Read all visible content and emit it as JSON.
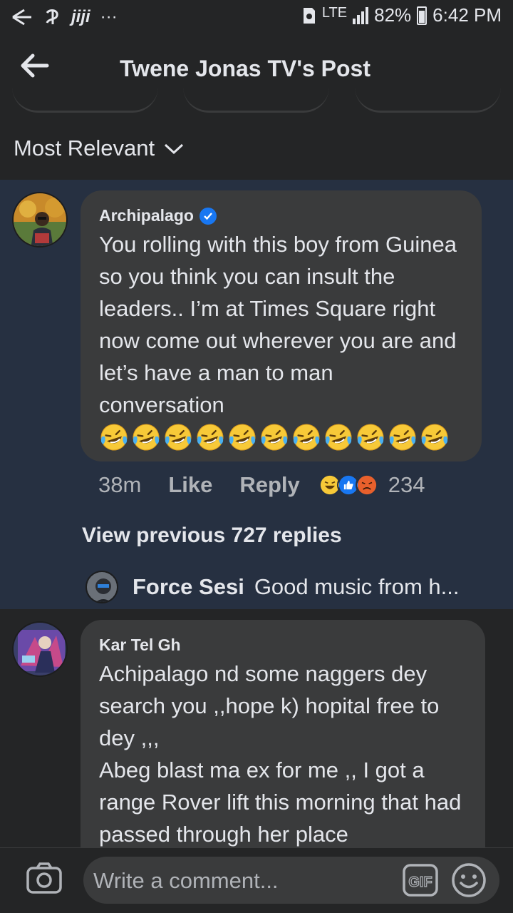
{
  "status_bar": {
    "left_icons": [
      "back-arrow-status-icon",
      "bluetooth-like-icon",
      "jiji-app-icon",
      "more-dots-icon"
    ],
    "jiji_label": "jiji",
    "dots": "···",
    "network": "LTE",
    "battery": "82%",
    "time": "6:42 PM"
  },
  "header": {
    "title": "Twene Jonas TV's Post"
  },
  "sort": {
    "label": "Most Relevant"
  },
  "comments": [
    {
      "author": "Archipalago",
      "verified": true,
      "text": "You rolling with this boy from Guinea so you think you can insult the leaders.. I’m at Times Square right now come out wherever you are and let’s have a man to man conversation",
      "emoji_count": 11,
      "time": "38m",
      "like_label": "Like",
      "reply_label": "Reply",
      "reaction_count": "234",
      "view_previous": "View previous 727 replies",
      "latest_reply": {
        "author": "Force Sesi",
        "snippet": "Good music from h..."
      }
    },
    {
      "author": "Kar Tel Gh",
      "verified": false,
      "text": "Achipalago nd some naggers dey search you ,,hope k) hopital free to dey ,,,\nAbeg blast ma ex for me ,, I got a range Rover lift this morning that had passed through her place"
    }
  ],
  "composer": {
    "placeholder": "Write a comment...",
    "gif_label": "GIF"
  },
  "colors": {
    "background": "#242526",
    "highlight": "#263041",
    "bubble": "#3a3b3c",
    "text": "#e4e6eb",
    "muted": "#b0b3b8",
    "verified": "#1877f2"
  }
}
